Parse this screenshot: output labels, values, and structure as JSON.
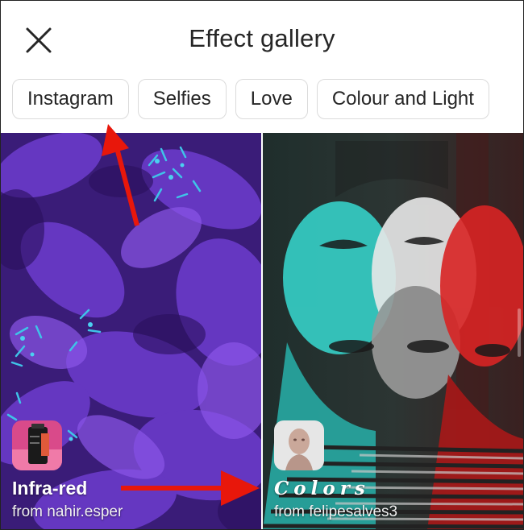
{
  "header": {
    "title": "Effect gallery",
    "close_icon": "close-icon"
  },
  "categories": [
    {
      "label": "Instagram"
    },
    {
      "label": "Selfies"
    },
    {
      "label": "Love"
    },
    {
      "label": "Colour and Light"
    }
  ],
  "effects": [
    {
      "name": "Infra-red",
      "author": "from nahir.esper",
      "thumbnail": "film-canister-icon"
    },
    {
      "name": "Colors",
      "author": "from felipesalves3",
      "thumbnail": "head-bust-icon"
    }
  ],
  "colors": {
    "annotation_arrow": "#e8170b",
    "chip_border": "#dbdbdb",
    "text": "#262626"
  }
}
